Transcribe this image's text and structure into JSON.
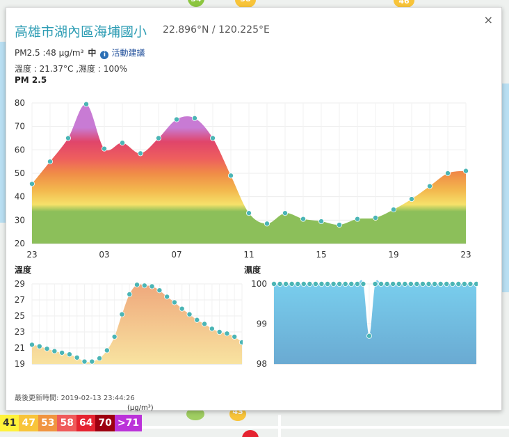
{
  "station": {
    "name": "高雄市湖內區海埔國小",
    "coords": "22.896°N / 120.225°E",
    "pm_label": "PM2.5 :48 μg/m³",
    "level": "中",
    "advice_link": "活動建議",
    "temp_humidity": "溫度 : 21.37°C ,濕度 : 100%",
    "updated": "最後更新時間: 2019-02-13 23:44:26"
  },
  "close_label": "×",
  "colors": {
    "accent": "#2e9db4",
    "point": "#4bb5b5"
  },
  "chart_data": [
    {
      "type": "area",
      "title": "PM 2.5",
      "ylim": [
        20,
        80
      ],
      "yticks": [
        "20",
        "30",
        "40",
        "50",
        "60",
        "70",
        "80"
      ],
      "xticks": [
        {
          "x": 0,
          "label": "23"
        },
        {
          "x": 4,
          "label": "03"
        },
        {
          "x": 8,
          "label": "07"
        },
        {
          "x": 12,
          "label": "11"
        },
        {
          "x": 16,
          "label": "15"
        },
        {
          "x": 20,
          "label": "19"
        },
        {
          "x": 24,
          "label": "23"
        }
      ],
      "values": [
        45.5,
        55,
        65,
        79.5,
        60.5,
        63,
        58.5,
        65,
        73,
        73.5,
        65,
        49,
        33,
        28.5,
        33,
        30.5,
        29.5,
        28,
        30.5,
        31,
        34.5,
        39,
        44.5,
        50,
        51
      ]
    },
    {
      "type": "area",
      "title": "溫度",
      "ylim": [
        19,
        29
      ],
      "yticks": [
        "19",
        "21",
        "23",
        "25",
        "27",
        "29"
      ],
      "values": [
        21.4,
        21.2,
        20.9,
        20.6,
        20.4,
        20.2,
        19.8,
        19.3,
        19.3,
        19.7,
        20.7,
        22.4,
        25.2,
        27.7,
        28.9,
        28.8,
        28.7,
        28.2,
        27.4,
        26.7,
        25.9,
        25.2,
        24.5,
        24.0,
        23.4,
        23.0,
        22.8,
        22.4,
        21.7
      ]
    },
    {
      "type": "area",
      "title": "濕度",
      "ylim": [
        98,
        100
      ],
      "yticks": [
        "98",
        "99",
        "100"
      ],
      "values": [
        100,
        100,
        100,
        100,
        100,
        100,
        100,
        100,
        100,
        100,
        100,
        100,
        100,
        100,
        100,
        100,
        98.7,
        100,
        100,
        100,
        100,
        100,
        100,
        100,
        100,
        100,
        100,
        100,
        100,
        100,
        100,
        100,
        100,
        100,
        100
      ]
    }
  ],
  "legend": {
    "unit": "(μg/m³)",
    "items": [
      {
        "label": "41",
        "bg": "#fff23a",
        "fg": "#333"
      },
      {
        "label": "47",
        "bg": "#f8c43a",
        "fg": "#fff"
      },
      {
        "label": "53",
        "bg": "#f09440",
        "fg": "#fff"
      },
      {
        "label": "58",
        "bg": "#ef5a5a",
        "fg": "#fff"
      },
      {
        "label": "64",
        "bg": "#e52330",
        "fg": "#fff"
      },
      {
        "label": "70",
        "bg": "#9d0010",
        "fg": "#fff"
      },
      {
        "label": ">71",
        "bg": "#bb33d9",
        "fg": "#fff"
      }
    ]
  },
  "map_markers": [
    "34",
    "38",
    "46",
    "43"
  ]
}
